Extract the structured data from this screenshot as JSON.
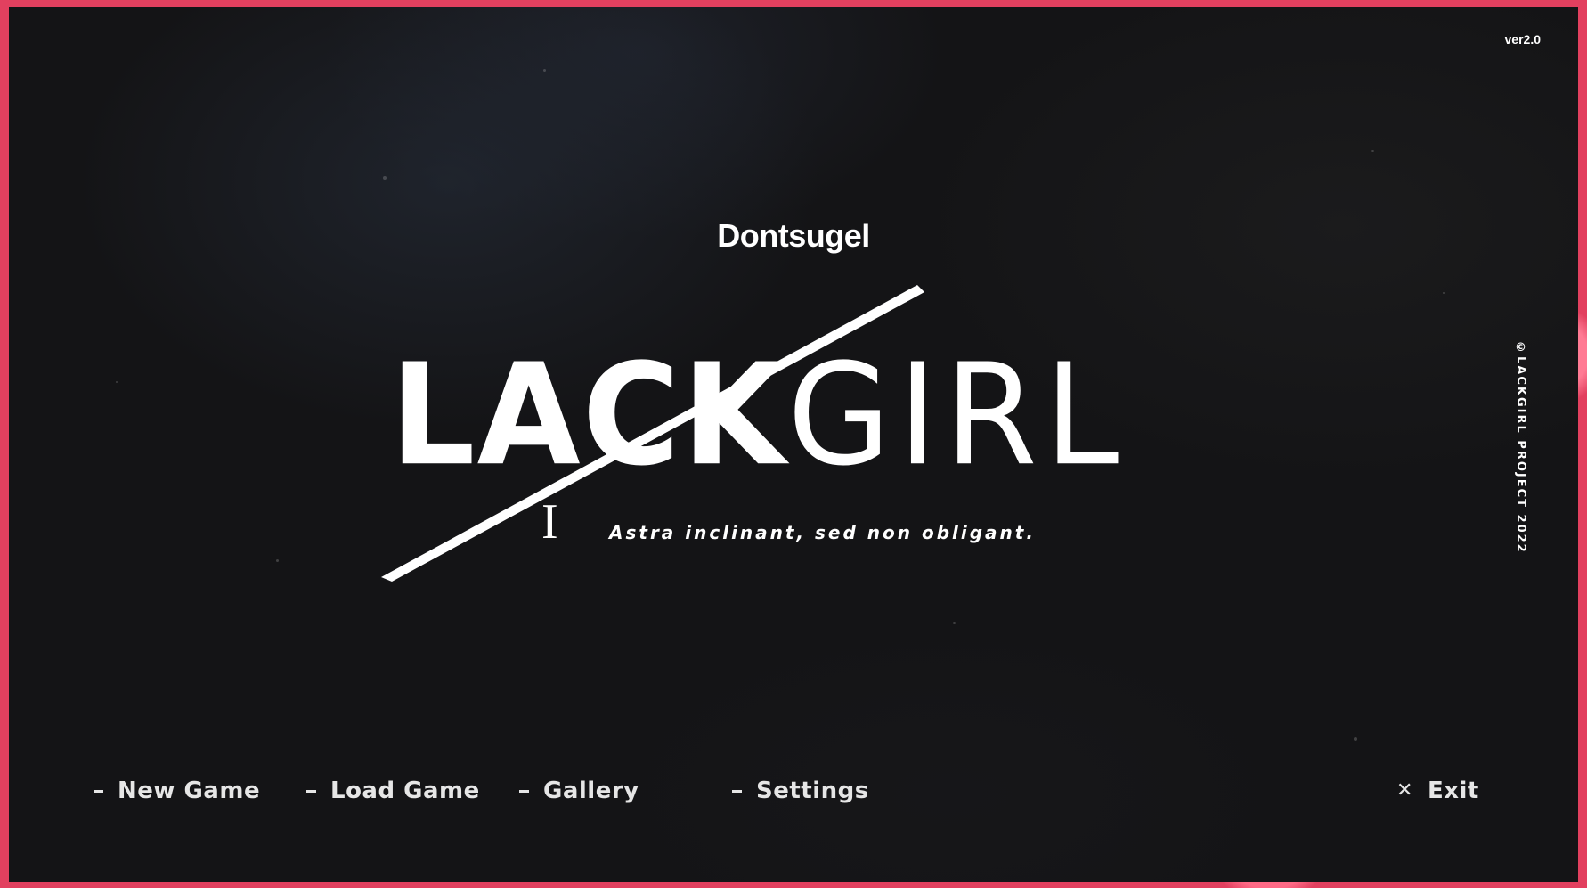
{
  "version": "ver2.0",
  "copyright": "©LACKGIRL PROJECT 2022",
  "studio": "Dontsugel",
  "logo": {
    "word_bold": "LACK",
    "word_thin": "GIRL",
    "volume": "I",
    "motto": "Astra inclinant, sed non obligant."
  },
  "menu": {
    "new_game": "New Game",
    "load_game": "Load Game",
    "gallery": "Gallery",
    "settings": "Settings",
    "exit": "Exit",
    "item_icon": "dash-icon",
    "exit_icon": "close-icon"
  },
  "colors": {
    "frame": "#e2405f",
    "background": "#141416",
    "text": "#ffffff"
  }
}
